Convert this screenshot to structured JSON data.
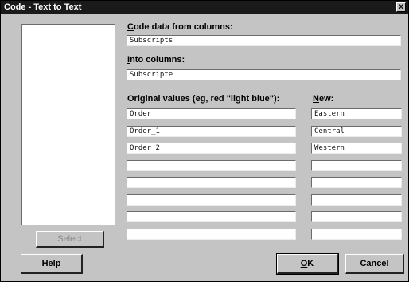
{
  "window": {
    "title": "Code - Text to Text",
    "close_glyph": "x"
  },
  "source": {
    "label_accel": "C",
    "label_rest": "ode data from columns:",
    "value": "Subscripts"
  },
  "target": {
    "label_accel": "I",
    "label_rest": "nto columns:",
    "value": "Subscripte"
  },
  "mapping": {
    "original_label": "Original values (eg, red \"light blue\"):",
    "new_label_accel": "N",
    "new_label_rest": "ew:",
    "rows": [
      {
        "original": "Order",
        "new": "Eastern"
      },
      {
        "original": "Order_1",
        "new": "Central"
      },
      {
        "original": "Order_2",
        "new": "Western"
      },
      {
        "original": "",
        "new": ""
      },
      {
        "original": "",
        "new": ""
      },
      {
        "original": "",
        "new": ""
      },
      {
        "original": "",
        "new": ""
      },
      {
        "original": "",
        "new": ""
      }
    ]
  },
  "buttons": {
    "select": "Select",
    "help": "Help",
    "ok_accel": "O",
    "ok_rest": "K",
    "cancel": "Cancel"
  }
}
